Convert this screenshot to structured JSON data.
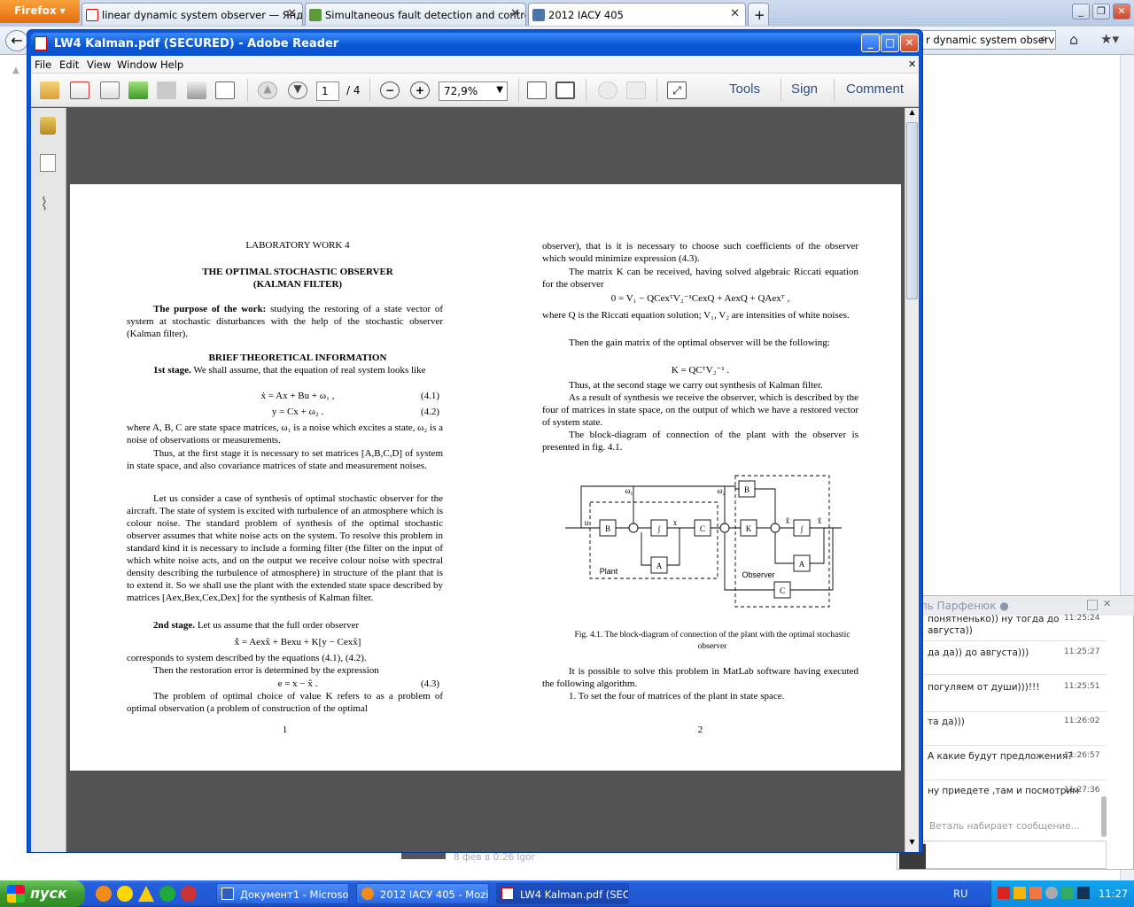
{
  "firefox": {
    "menu_label": "Firefox",
    "tabs": [
      {
        "label": "linear dynamic system observer — Янде..."
      },
      {
        "label": "Simultaneous fault detection and control ..."
      },
      {
        "label": "2012 ІАСУ 405"
      }
    ],
    "search_value": "r dynamic system observer"
  },
  "adobe": {
    "title": "LW4 Kalman.pdf (SECURED) - Adobe Reader",
    "menu": [
      "File",
      "Edit",
      "View",
      "Window",
      "Help"
    ],
    "page_current": "1",
    "page_total": "/ 4",
    "zoom": "72,9%",
    "right_tools": [
      "Tools",
      "Sign",
      "Comment"
    ]
  },
  "pdf": {
    "lab_title": "LABORATORY WORK 4",
    "title1": "THE OPTIMAL STOCHASTIC OBSERVER",
    "title2": "(KALMAN FILTER)",
    "purpose_label": "The purpose of the work:",
    "purpose_text": " studying the restoring of a state vector of system at stochastic disturbances with the help of the stochastic observer (Kalman filter).",
    "brief": "BRIEF THEORETICAL INFORMATION",
    "stage1_label": "1st stage.",
    "stage1_text": " We shall assume, that the equation of real system looks like",
    "eq1": "ẋ = Ax + Bu + ω₁ ,",
    "eq1_no": "(4.1)",
    "eq2": "y = Cx + ω₂ .",
    "eq2_no": "(4.2)",
    "where1": "where A, B, C are state space matrices, ω₁ is a noise which excites a state, ω₂ is a noise of observations or measurements.",
    "thus1": "Thus, at the first stage it is necessary to set matrices [A,B,C,D] of system in state space, and also covariance matrices of state and measurement noises.",
    "consider": "Let us consider a case of synthesis of optimal stochastic observer for the aircraft. The state of system is excited with turbulence of an atmosphere which is colour noise. The standard problem of synthesis of the optimal stochastic observer assumes that white noise acts on the system. To resolve this problem in standard kind it is necessary to include a forming filter (the filter on the input of which white noise acts, and on the output we receive colour noise with spectral density describing the turbulence of atmosphere) in structure of the plant that is to extend it. So we shall use the plant with the extended state space described by matrices [Aex,Bex,Cex,Dex] for the synthesis of Kalman filter.",
    "stage2_label": "2nd stage.",
    "stage2_text": " Let us assume that the full order observer",
    "eq3": "x̂̇ = Aexx̂ + Bexu + K[y − Cexx̂]",
    "corresponds": "corresponds to system described by the equations (4.1), (4.2).",
    "restoration": "Then the restoration error is determined by the expression",
    "eq4": "e = x − x̂ .",
    "eq4_no": "(4.3)",
    "optimal": "The problem of optimal choice of value K refers to as a problem of optimal observation (a problem of construction of the optimal",
    "page1": "1",
    "r_cont": "observer), that is it is necessary to choose such coefficients of the observer which would minimize expression (4.3).",
    "r_matrix": "The matrix K can be received, having solved algebraic Riccati equation for the observer",
    "r_eq": "0 = V₁ − QCexᵀV₂⁻¹CexQ + AexQ + QAexᵀ ,",
    "r_where": "where Q is the Riccati equation solution; V₁, V₂ are intensities of white noises.",
    "r_gain": "Then the gain matrix of the optimal observer will be the following:",
    "r_keq": "K = QCᵀV₂⁻¹ .",
    "r_thus": "Thus, at the second stage we carry out synthesis of Kalman filter.",
    "r_result": "As a result of synthesis we receive the observer, which is described by the four of matrices in state space, on the output of which we have a restored vector of system state.",
    "r_block": "The block-diagram of connection of the plant with the observer is presented in fig. 4.1.",
    "fig_caption": "Fig. 4.1. The block-diagram of connection of the plant with the optimal stochastic observer",
    "r_matlab": "It is possible to solve this problem in MatLab software having executed the following algorithm.",
    "r_step1": "1. To set the four of matrices of the plant in state space.",
    "page2": "2",
    "diagram": {
      "plant": "Plant",
      "observer": "Observer",
      "B": "B",
      "A": "A",
      "C": "C",
      "K": "K",
      "int": "∫",
      "u": "u",
      "x": "x",
      "w1": "ω₁",
      "w2": "ω₂",
      "xhat": "x̂",
      "xhatdot": "x̂̇"
    }
  },
  "chat": {
    "header": "ль Парфенюк ●",
    "messages": [
      {
        "text": "понятненько)) ну тогда до августа))",
        "time": "11:25:24"
      },
      {
        "text": "да да)) до августа)))",
        "time": "11:25:27"
      },
      {
        "text": "погуляем от души)))!!!",
        "time": "11:25:51"
      },
      {
        "text": "та да)))",
        "time": "11:26:02"
      },
      {
        "text": "А какие будут предложения?",
        "time": "11:26:57"
      },
      {
        "text": "ну приедете ,там и посмотрим",
        "time": "11:27:36"
      }
    ],
    "typing": "Веталь набирает сообщение..."
  },
  "background": {
    "feed_text": "8 фев в 0:26 Igor"
  },
  "taskbar": {
    "start": "пуск",
    "tasks": [
      "Документ1 - Microso...",
      "2012 ІАСУ 405 - Mozi...",
      "LW4 Kalman.pdf (SEC..."
    ],
    "lang": "RU",
    "clock": "11:27"
  }
}
